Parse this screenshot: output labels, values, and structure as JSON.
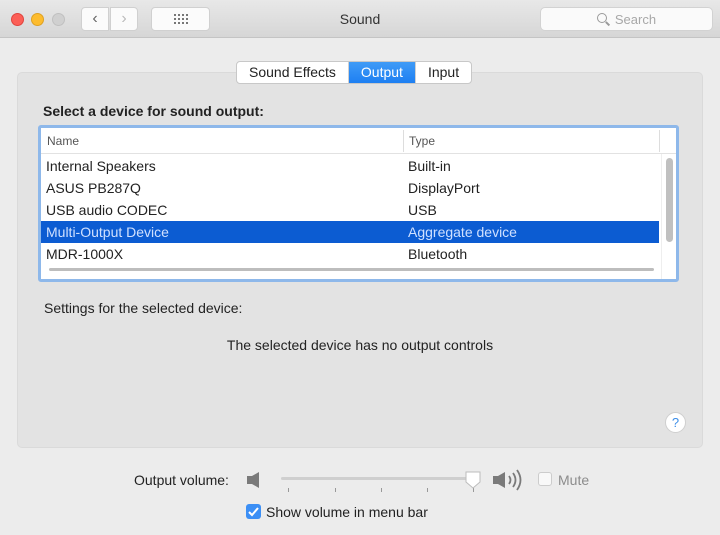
{
  "window": {
    "title": "Sound",
    "search_placeholder": "Search"
  },
  "tabs": [
    {
      "label": "Sound Effects",
      "active": false
    },
    {
      "label": "Output",
      "active": true
    },
    {
      "label": "Input",
      "active": false
    }
  ],
  "output": {
    "section_label": "Select a device for sound output:",
    "columns": [
      "Name",
      "Type"
    ],
    "devices": [
      {
        "name": "Internal Speakers",
        "type": "Built-in",
        "selected": false
      },
      {
        "name": "ASUS PB287Q",
        "type": "DisplayPort",
        "selected": false
      },
      {
        "name": "USB audio CODEC",
        "type": "USB",
        "selected": false
      },
      {
        "name": "Multi-Output Device",
        "type": "Aggregate device",
        "selected": true
      },
      {
        "name": "MDR-1000X",
        "type": "Bluetooth",
        "selected": false
      }
    ],
    "settings_label": "Settings for the selected device:",
    "no_controls_message": "The selected device has no output controls",
    "help_label": "?"
  },
  "volume": {
    "label": "Output volume:",
    "level_percent": 100,
    "mute_label": "Mute",
    "muted": false,
    "show_in_menu_bar_label": "Show volume in menu bar",
    "show_in_menu_bar": true
  },
  "colors": {
    "accent": "#1e7ff2",
    "selection": "#0c5cd2",
    "focus_ring": "#8eb8ea"
  }
}
